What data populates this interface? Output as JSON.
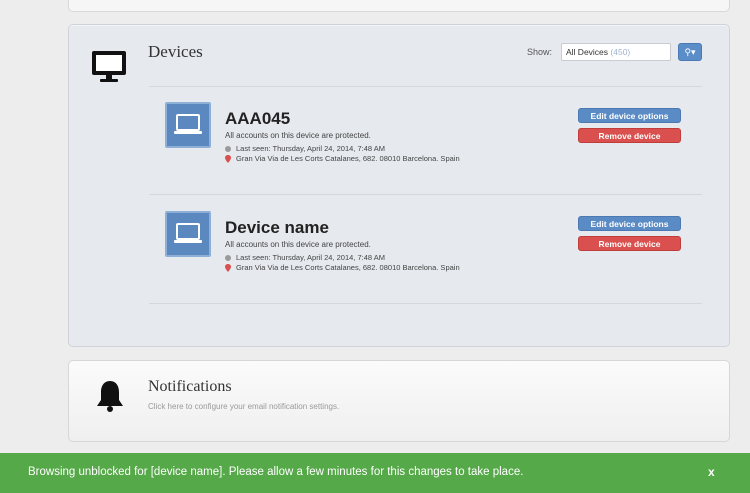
{
  "devices": {
    "title": "Devices",
    "show_label": "Show:",
    "filter_value": "All Devices",
    "filter_count": "(450)",
    "search_icon": "search-icon",
    "items": [
      {
        "name": "AAA045",
        "status": "All accounts on this device are protected.",
        "last_seen": "Last seen: Thursday, April 24, 2014, 7:48 AM",
        "location": "Gran Via Via de Les Corts Catalanes, 682. 08010 Barcelona. Spain",
        "edit_label": "Edit device options",
        "remove_label": "Remove device"
      },
      {
        "name": "Device name",
        "status": "All accounts on this device are protected.",
        "last_seen": "Last seen: Thursday, April 24, 2014, 7:48 AM",
        "location": "Gran Via Via de Les Corts Catalanes, 682. 08010 Barcelona. Spain",
        "edit_label": "Edit device options",
        "remove_label": "Remove device"
      }
    ]
  },
  "notifications": {
    "title": "Notifications",
    "subtitle": "Click here to configure your email notification settings."
  },
  "toast": {
    "message": "Browsing unblocked for [device name]. Please allow a few minutes for this changes to take place.",
    "close_label": "x"
  },
  "colors": {
    "accent": "#5b8bc4",
    "danger": "#d9504e",
    "success": "#55a948"
  }
}
